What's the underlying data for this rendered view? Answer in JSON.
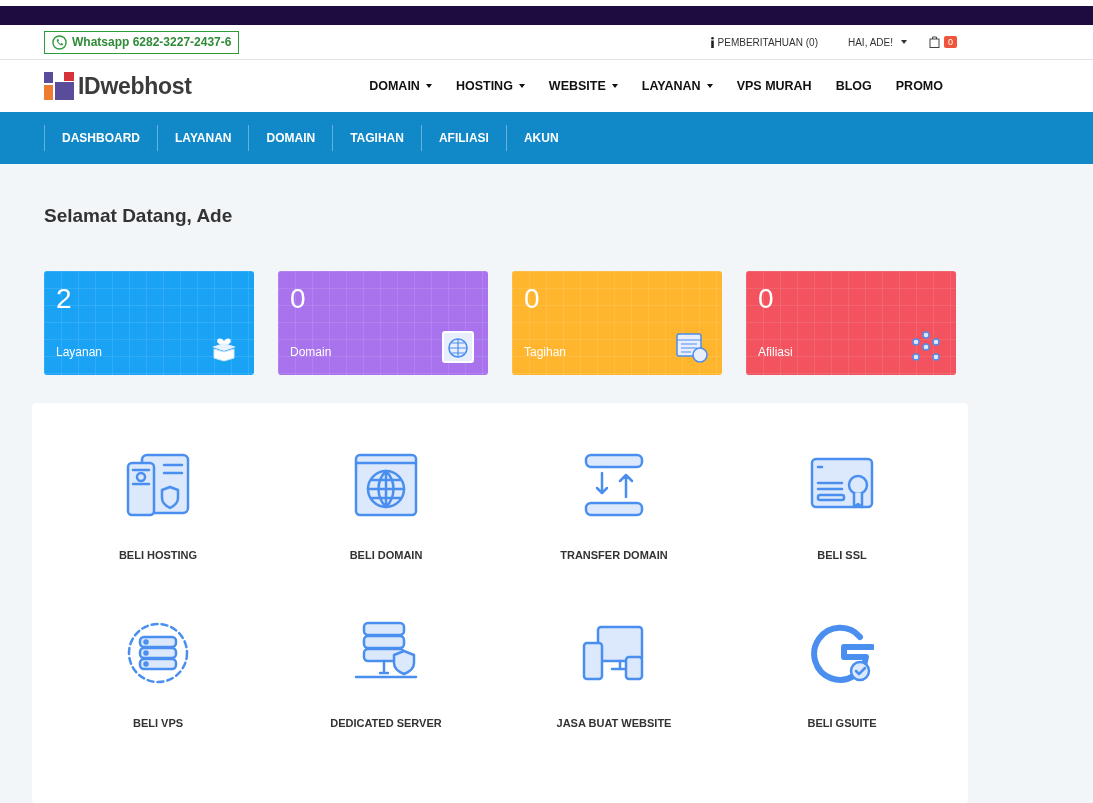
{
  "topbar": {
    "whatsapp": "Whatsapp 6282-3227-2437-6",
    "notifications": "PEMBERITAHUAN (0)",
    "user_menu": "HAI, ADE!",
    "cart_count": "0"
  },
  "header": {
    "logo": "IDwebhost",
    "menu": [
      {
        "label": "DOMAIN",
        "has_dropdown": true
      },
      {
        "label": "HOSTING",
        "has_dropdown": true
      },
      {
        "label": "WEBSITE",
        "has_dropdown": true
      },
      {
        "label": "LAYANAN",
        "has_dropdown": true
      },
      {
        "label": "VPS MURAH",
        "has_dropdown": false
      },
      {
        "label": "BLOG",
        "has_dropdown": false
      },
      {
        "label": "PROMO",
        "has_dropdown": false
      }
    ]
  },
  "subnav": [
    "DASHBOARD",
    "LAYANAN",
    "DOMAIN",
    "TAGIHAN",
    "AFILIASI",
    "AKUN"
  ],
  "welcome": "Selamat Datang, Ade",
  "stats": [
    {
      "value": "2",
      "label": "Layanan",
      "color": "#1aa3f5"
    },
    {
      "value": "0",
      "label": "Domain",
      "color": "#a873ec"
    },
    {
      "value": "0",
      "label": "Tagihan",
      "color": "#ffb52e"
    },
    {
      "value": "0",
      "label": "Afiliasi",
      "color": "#f2535e"
    }
  ],
  "actions": [
    "BELI HOSTING",
    "BELI DOMAIN",
    "TRANSFER DOMAIN",
    "BELI SSL",
    "BELI VPS",
    "DEDICATED SERVER",
    "JASA BUAT WEBSITE",
    "BELI GSUITE"
  ]
}
